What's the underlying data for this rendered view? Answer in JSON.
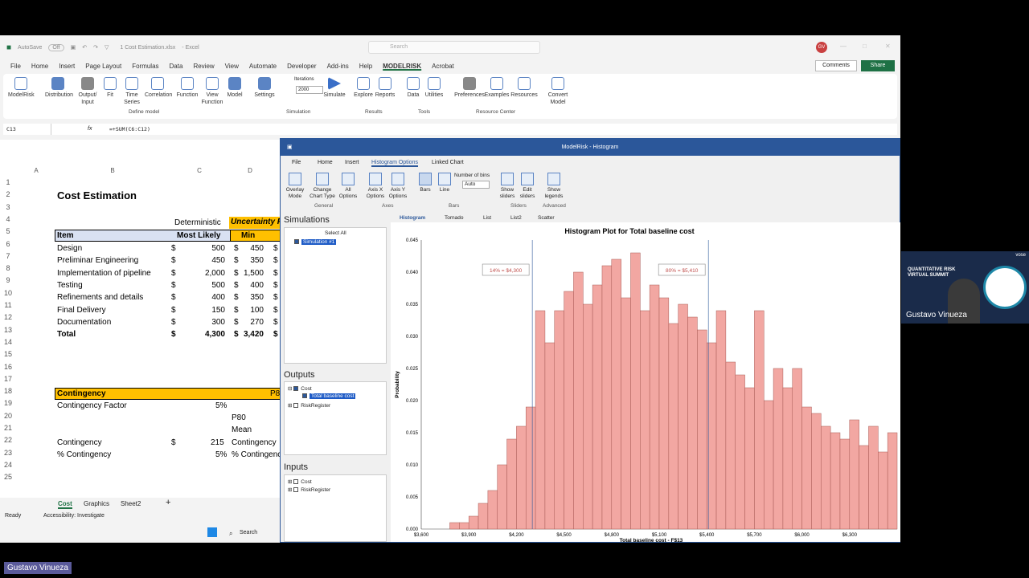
{
  "excel": {
    "autosave": "AutoSave",
    "autosave_state": "Off",
    "filename": "1 Cost Estimation.xlsx",
    "app": "Excel",
    "search_placeholder": "Search",
    "user_initials": "GV",
    "menu": [
      "File",
      "Home",
      "Insert",
      "Page Layout",
      "Formulas",
      "Data",
      "Review",
      "View",
      "Automate",
      "Developer",
      "Add-ins",
      "Help",
      "MODELRISK",
      "Acrobat"
    ],
    "menu_active": "MODELRISK",
    "comments": "Comments",
    "share": "Share",
    "ribbon": {
      "buttons": [
        "ModelRisk",
        "Distribution",
        "Output/ Input",
        "Fit",
        "Time Series",
        "Correlation",
        "Function",
        "View Function",
        "Model",
        "Settings"
      ],
      "iterations_label": "Iterations",
      "iterations_value": "2000",
      "simulate": "Simulate",
      "explore": "Explore",
      "reports": "Reports",
      "data": "Data",
      "utilities": "Utilities",
      "preferences": "Preferences",
      "examples": "Examples",
      "resources": "Resources",
      "convert_model": "Convert Model",
      "groups": {
        "define": "Define model",
        "simulation": "Simulation",
        "results": "Results",
        "tools": "Tools",
        "resource_center": "Resource Center"
      }
    },
    "name_box": "C13",
    "fx": "fx",
    "formula": "=+SUM(C6:C12)",
    "columns": [
      "A",
      "B",
      "C",
      "D"
    ],
    "rows": [
      "1",
      "2",
      "3",
      "4",
      "5",
      "6",
      "7",
      "8",
      "9",
      "10",
      "11",
      "12",
      "13",
      "14",
      "15",
      "16",
      "17",
      "18",
      "19",
      "20",
      "21",
      "22",
      "23",
      "24",
      "25"
    ],
    "sheet": {
      "title": "Cost Estimation",
      "deterministic": "Deterministic",
      "uncertainty": "Uncertainty R",
      "hdr_item": "Item",
      "hdr_most_likely": "Most Likely",
      "hdr_min": "Min",
      "items": [
        {
          "name": "Design",
          "ml": "500",
          "min": "450"
        },
        {
          "name": "Preliminar Engineering",
          "ml": "450",
          "min": "350"
        },
        {
          "name": "Implementation of pipeline",
          "ml": "2,000",
          "min": "1,500"
        },
        {
          "name": "Testing",
          "ml": "500",
          "min": "400"
        },
        {
          "name": "Refinements and details",
          "ml": "400",
          "min": "350"
        },
        {
          "name": "Final Delivery",
          "ml": "150",
          "min": "100"
        },
        {
          "name": "Documentation",
          "ml": "300",
          "min": "270"
        }
      ],
      "total_label": "Total",
      "total_ml": "4,300",
      "total_min": "3,420",
      "currency": "$",
      "contingency_hdr": "Contingency",
      "p80_hdr": "P8",
      "contingency_factor_label": "Contingency Factor",
      "contingency_factor": "5%",
      "p80": "P80",
      "mean": "Mean",
      "contingency_label": "Contingency",
      "contingency_value": "215",
      "contingency_d": "Contingency",
      "pct_contingency_label": "% Contingency",
      "pct_contingency": "5%",
      "pct_contingency_d": "% Contingenc"
    },
    "sheet_tabs": [
      "Cost",
      "Graphics",
      "Sheet2"
    ],
    "status_ready": "Ready",
    "accessibility": "Accessibility: Investigate",
    "taskbar_search": "Search"
  },
  "modelrisk": {
    "title": "ModelRisk - Histogram",
    "menu": [
      "File",
      "Home",
      "Insert",
      "Histogram Options",
      "Linked Chart"
    ],
    "menu_active": "Histogram Options",
    "ribbon_buttons": [
      "Overlay Mode",
      "Change Chart Type",
      "All Options",
      "Axis X Options",
      "Axis Y Options",
      "Bars",
      "Line",
      "Show sliders",
      "Edit sliders",
      "Show legends"
    ],
    "bins_label": "Number of bins",
    "bins_value": "Auto",
    "groups": [
      "General",
      "Axes",
      "Bars",
      "Sliders",
      "Advanced"
    ],
    "simulations_title": "Simulations",
    "select_all": "Select All",
    "simulation_item": "Simulation #1",
    "outputs_title": "Outputs",
    "outputs_tree": [
      "Cost",
      "Total baseline cost",
      "RiskRegister"
    ],
    "inputs_title": "Inputs",
    "inputs_tree": [
      "Cost",
      "RiskRegister"
    ],
    "chart_tabs": [
      "Histogram",
      "Tornado",
      "List",
      "List2",
      "Scatter"
    ]
  },
  "chart_data": {
    "type": "bar",
    "title": "Histogram Plot for Total baseline cost",
    "xlabel": "Total baseline cost - F$13",
    "ylabel": "Probability",
    "xlim": [
      3600,
      6600
    ],
    "ylim": [
      0,
      0.045
    ],
    "x_ticks": [
      "$3,600",
      "$3,900",
      "$4,200",
      "$4,500",
      "$4,800",
      "$5,100",
      "$5,400",
      "$5,700",
      "$6,000",
      "$6,300"
    ],
    "y_ticks": [
      "0.000",
      "0.005",
      "0.010",
      "0.015",
      "0.020",
      "0.025",
      "0.030",
      "0.035",
      "0.040",
      "0.045"
    ],
    "bin_width": 60,
    "bins_start": 3780,
    "values": [
      0.001,
      0.001,
      0.002,
      0.004,
      0.006,
      0.01,
      0.014,
      0.016,
      0.019,
      0.034,
      0.029,
      0.034,
      0.037,
      0.04,
      0.035,
      0.038,
      0.041,
      0.042,
      0.036,
      0.043,
      0.034,
      0.038,
      0.036,
      0.032,
      0.035,
      0.033,
      0.031,
      0.029,
      0.034,
      0.026,
      0.024,
      0.022,
      0.034,
      0.02,
      0.025,
      0.022,
      0.025,
      0.019,
      0.018,
      0.016,
      0.015,
      0.014,
      0.017,
      0.013,
      0.016,
      0.012,
      0.015,
      0.01,
      0.012,
      0.008,
      0.006,
      0.005,
      0.004,
      0.003,
      0.002,
      0.001
    ],
    "sliders": [
      {
        "value": 4300,
        "label": "14% = $4,300"
      },
      {
        "value": 5410,
        "label": "80% = $5,410"
      }
    ],
    "colors": {
      "bar": "#f2a7a2",
      "bar_edge": "#a85a55",
      "slider": "#2b579a"
    }
  },
  "webcam": {
    "brand": "vose",
    "summit": "QUANTITATIVE RISK VIRTUAL SUMMIT",
    "speaker": "Gustavo Vinueza"
  },
  "participant_name": "Gustavo Vinueza"
}
